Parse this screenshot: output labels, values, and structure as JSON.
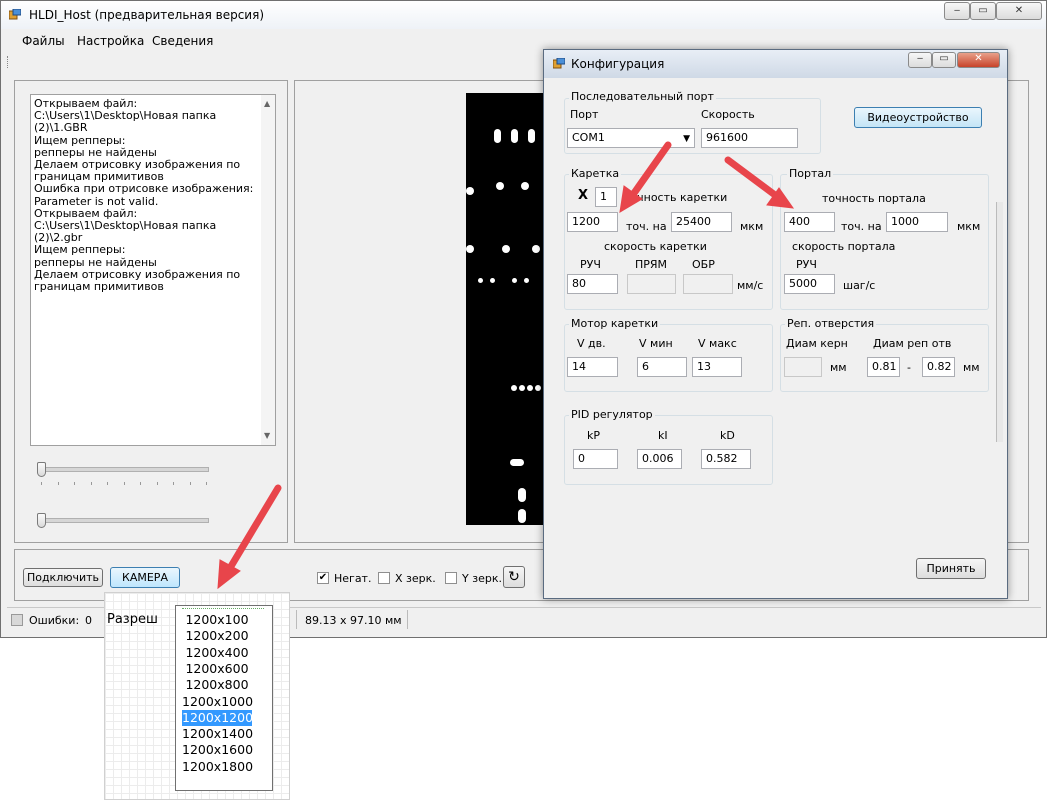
{
  "app": {
    "title": "HLDI_Host (предварительная версия)"
  },
  "menu": [
    "Файлы",
    "Настройка",
    "Сведения"
  ],
  "log": [
    "Открываем файл: C:\\Users\\1\\Desktop\\Новая папка (2)\\1.GBR",
    "Ищем репперы:",
    "репперы не найдены",
    "Делаем отрисовку изображения по границам примитивов",
    "Ошибка при отрисовке изображения:",
    "Parameter is not valid.",
    "Открываем файл: C:\\Users\\1\\Desktop\\Новая папка (2)\\2.gbr",
    "Ищем репперы:",
    "репперы не найдены",
    "Делаем отрисовку изображения по границам примитивов"
  ],
  "controls": {
    "connect": "Подключить",
    "camera": "КАМЕРА",
    "negative": {
      "label": "Негат.",
      "checked": true
    },
    "x_mirror": {
      "label": "X зерк.",
      "checked": false
    },
    "y_mirror": {
      "label": "Y зерк.",
      "checked": false
    }
  },
  "status": {
    "errors_label": "Ошибки:",
    "errors_value": "0",
    "dims": "89.13  x  97.10   мм"
  },
  "config": {
    "title": "Конфигурация",
    "serial": {
      "group": "Последовательный порт",
      "port_label": "Порт",
      "speed_label": "Скорость",
      "port_value": "COM1",
      "speed_value": "961600"
    },
    "video_button": "Видеоустройство",
    "carriage": {
      "group": "Каретка",
      "x_label": "X",
      "x_value": "1",
      "accuracy_label": "точность каретки",
      "steps": "1200",
      "per_label": "точ. на",
      "distance": "25400",
      "unit": "мкм",
      "speed_label": "скорость каретки",
      "manual_label": "РУЧ",
      "direct_label": "ПРЯМ",
      "reverse_label": "ОБР",
      "manual": "80",
      "direct": "",
      "reverse": "",
      "speed_unit": "мм/с"
    },
    "portal": {
      "group": "Портал",
      "accuracy_label": "точность портала",
      "steps": "400",
      "per_label": "точ. на",
      "distance": "1000",
      "unit": "мкм",
      "speed_label": "скорость портала",
      "manual_label": "РУЧ",
      "manual": "5000",
      "speed_unit": "шаг/с"
    },
    "motor": {
      "group": "Мотор каретки",
      "v_run_label": "V дв.",
      "v_min_label": "V мин",
      "v_max_label": "V макс",
      "v_run": "14",
      "v_min": "6",
      "v_max": "13"
    },
    "holes": {
      "group": "Реп. отверстия",
      "core_label": "Диам керн",
      "hole_label": "Диам реп отв",
      "core": "",
      "mm1": "мм",
      "min": "0.81",
      "dash": "-",
      "max": "0.82",
      "mm2": "мм"
    },
    "pid": {
      "group": "PID регулятор",
      "kp_label": "kP",
      "ki_label": "kI",
      "kd_label": "kD",
      "kp": "0",
      "ki": "0.006",
      "kd": "0.582"
    },
    "accept": "Принять"
  },
  "resolution": {
    "label": "Разреш",
    "options": [
      "1200x100",
      "1200x200",
      "1200x400",
      "1200x600",
      "1200x800",
      "1200x1000",
      "1200x1200",
      "1200x1400",
      "1200x1600",
      "1200x1800"
    ],
    "selected_index": 6
  },
  "colors": {
    "arrow": "#e8454b",
    "selection": "#3399ff"
  }
}
